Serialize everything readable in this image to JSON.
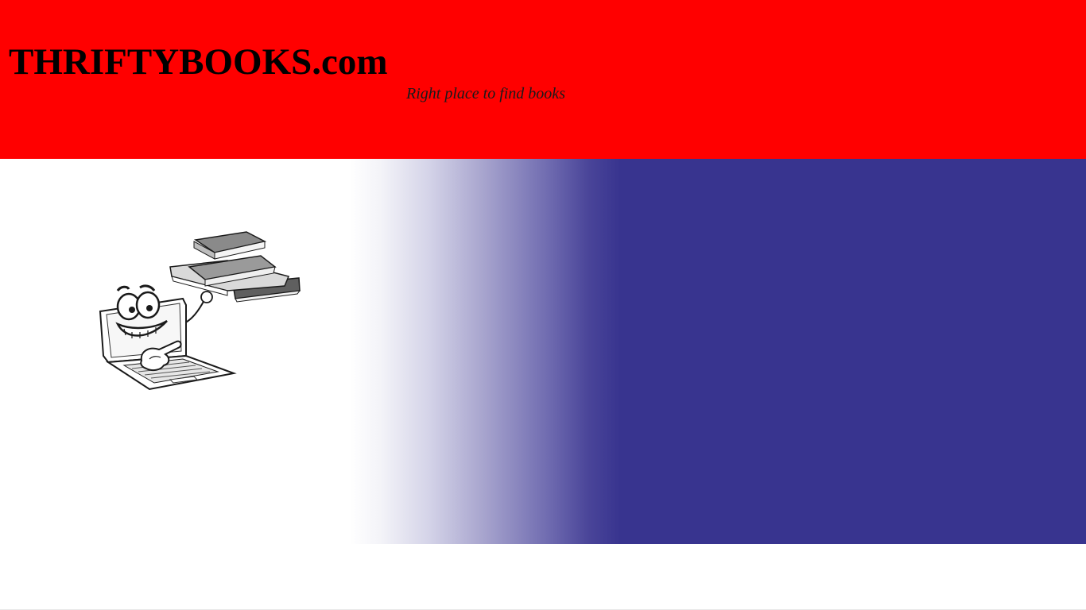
{
  "header": {
    "site_title": "THRIFTYBOOKS.com",
    "tagline": "Right place to find books"
  },
  "hero": {
    "illustration": "laptop-mascot-holding-books-icon"
  },
  "colors": {
    "header_background": "#ff0000",
    "hero_gradient_end": "#38348f",
    "title_text": "#000000",
    "page_background": "#ffffff"
  }
}
